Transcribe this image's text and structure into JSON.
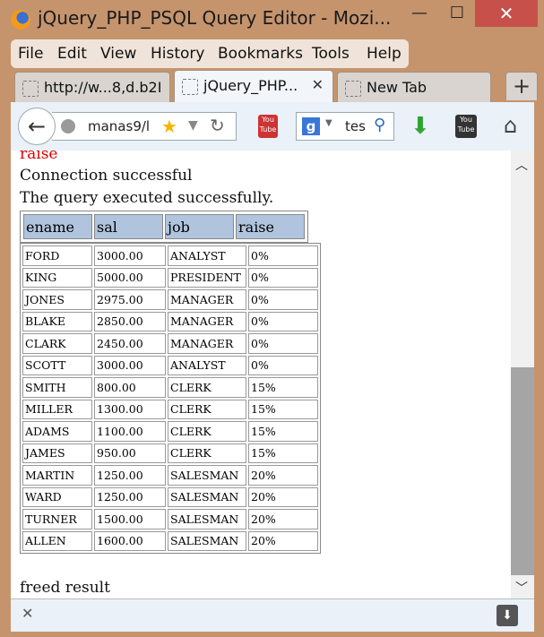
{
  "window": {
    "title": "jQuery_PHP_PSQL Query Editor - Mozi..."
  },
  "menu": [
    "File",
    "Edit",
    "View",
    "History",
    "Bookmarks",
    "Tools",
    "Help"
  ],
  "tabs": [
    {
      "label": "http://w...8,d.b2I"
    },
    {
      "label": "jQuery_PHP...",
      "close": "✕"
    },
    {
      "label": "New Tab"
    }
  ],
  "newtab_label": "+",
  "nav": {
    "url": "manas9/l",
    "search": "tes"
  },
  "page": {
    "clipped_heading": "raise",
    "conn_msg": "Connection successful",
    "query_msg": "The query executed successfully.",
    "columns": [
      "ename",
      "sal",
      "job",
      "raise"
    ],
    "rows": [
      [
        "FORD",
        "3000.00",
        "ANALYST",
        "0%"
      ],
      [
        "KING",
        "5000.00",
        "PRESIDENT",
        "0%"
      ],
      [
        "JONES",
        "2975.00",
        "MANAGER",
        "0%"
      ],
      [
        "BLAKE",
        "2850.00",
        "MANAGER",
        "0%"
      ],
      [
        "CLARK",
        "2450.00",
        "MANAGER",
        "0%"
      ],
      [
        "SCOTT",
        "3000.00",
        "ANALYST",
        "0%"
      ],
      [
        "SMITH",
        "800.00",
        "CLERK",
        "15%"
      ],
      [
        "MILLER",
        "1300.00",
        "CLERK",
        "15%"
      ],
      [
        "ADAMS",
        "1100.00",
        "CLERK",
        "15%"
      ],
      [
        "JAMES",
        "950.00",
        "CLERK",
        "15%"
      ],
      [
        "MARTIN",
        "1250.00",
        "SALESMAN",
        "20%"
      ],
      [
        "WARD",
        "1250.00",
        "SALESMAN",
        "20%"
      ],
      [
        "TURNER",
        "1500.00",
        "SALESMAN",
        "20%"
      ],
      [
        "ALLEN",
        "1600.00",
        "SALESMAN",
        "20%"
      ]
    ],
    "footer_msg": "freed result"
  },
  "colors": {
    "header_cell": "#b0c4de",
    "raise_text": "#e00000",
    "close_button": "#c7504a"
  }
}
